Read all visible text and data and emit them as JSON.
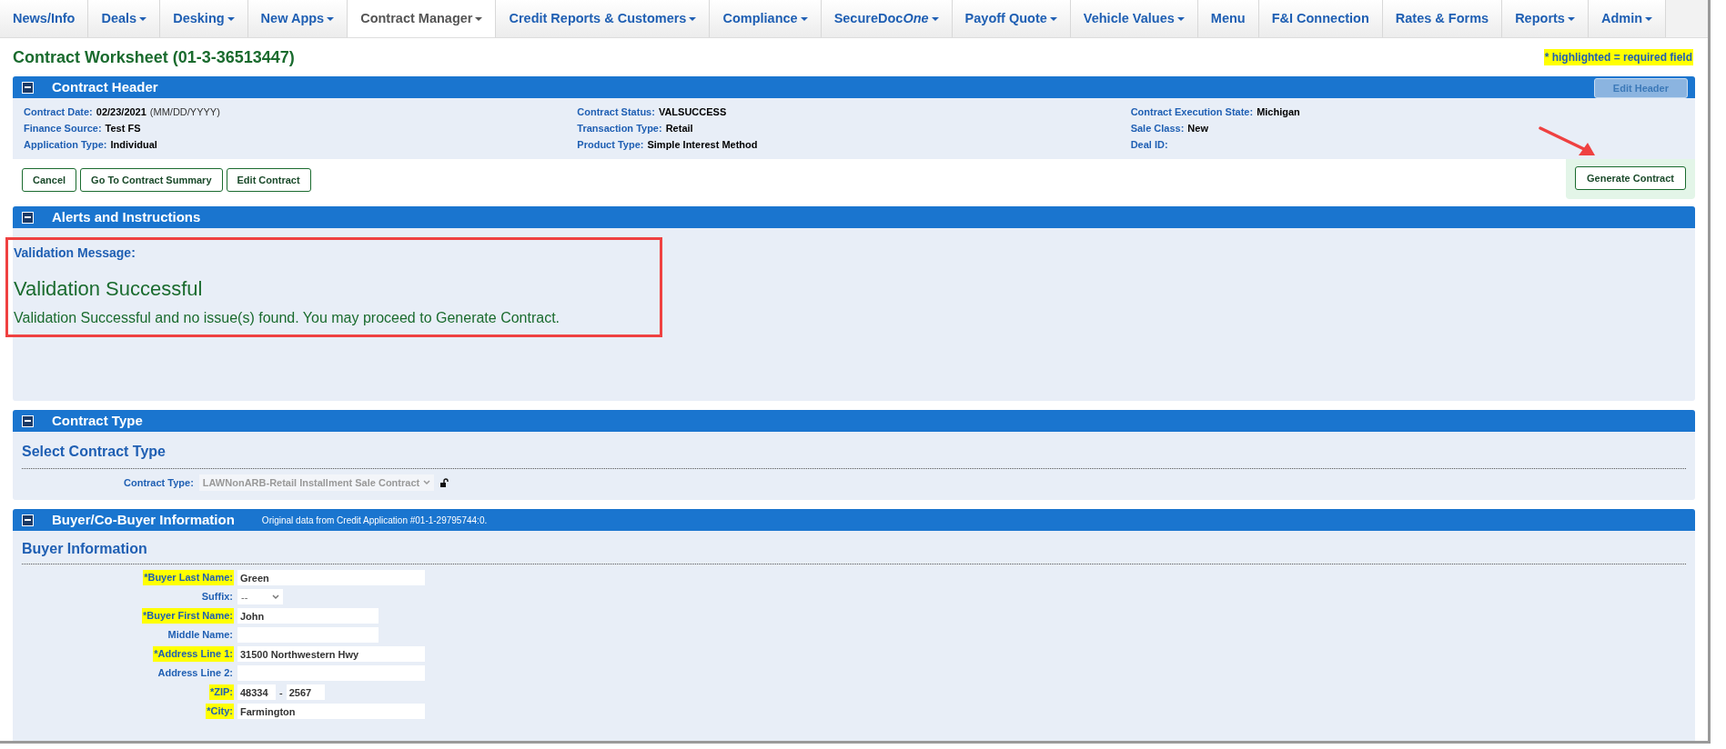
{
  "nav": [
    {
      "label": "News/Info",
      "dropdown": false,
      "selected": false
    },
    {
      "label": "Deals",
      "dropdown": true,
      "selected": false
    },
    {
      "label": "Desking",
      "dropdown": true,
      "selected": false
    },
    {
      "label": "New Apps",
      "dropdown": true,
      "selected": false
    },
    {
      "label": "Contract Manager",
      "dropdown": true,
      "selected": true
    },
    {
      "label": "Credit Reports & Customers",
      "dropdown": true,
      "selected": false
    },
    {
      "label": "Compliance",
      "dropdown": true,
      "selected": false
    },
    {
      "label": "SecureDoc",
      "label_italic": "One",
      "dropdown": true,
      "selected": false
    },
    {
      "label": "Payoff Quote",
      "dropdown": true,
      "selected": false
    },
    {
      "label": "Vehicle Values",
      "dropdown": true,
      "selected": false
    },
    {
      "label": "Menu",
      "dropdown": false,
      "selected": false
    },
    {
      "label": "F&I Connection",
      "dropdown": false,
      "selected": false
    },
    {
      "label": "Rates & Forms",
      "dropdown": false,
      "selected": false
    },
    {
      "label": "Reports",
      "dropdown": true,
      "selected": false
    },
    {
      "label": "Admin",
      "dropdown": true,
      "selected": false
    }
  ],
  "page_title": "Contract Worksheet (01-3-36513447)",
  "required_note": "* highlighted = required field",
  "contract_header": {
    "title": "Contract Header",
    "edit_button": "Edit Header",
    "columns": [
      [
        {
          "label": "Contract Date:",
          "value": "02/23/2021",
          "hint": "(MM/DD/YYYY)"
        },
        {
          "label": "Finance Source:",
          "value": "Test FS"
        },
        {
          "label": "Application Type:",
          "value": "Individual"
        }
      ],
      [
        {
          "label": "Contract Status:",
          "value": "VALSUCCESS"
        },
        {
          "label": "Transaction Type:",
          "value": "Retail"
        },
        {
          "label": "Product Type:",
          "value": "Simple Interest Method"
        }
      ],
      [
        {
          "label": "Contract Execution State:",
          "value": "Michigan"
        },
        {
          "label": "Sale Class:",
          "value": "New"
        },
        {
          "label": "Deal ID:"
        }
      ]
    ]
  },
  "actions": [
    "Cancel",
    "Go To Contract Summary",
    "Edit Contract"
  ],
  "generate_button": "Generate Contract",
  "alerts": {
    "title": "Alerts and Instructions",
    "label": "Validation Message:",
    "heading": "Validation Successful",
    "message": "Validation Successful and no issue(s) found. You may proceed to Generate Contract."
  },
  "contract_type": {
    "title": "Contract Type",
    "subtitle": "Select Contract Type",
    "label": "Contract Type:",
    "value": "LAWNonARB-Retail Installment Sale Contract",
    "disabled": true
  },
  "buyer": {
    "title": "Buyer/Co-Buyer Information",
    "note": "Original data from Credit Application #01-1-29795744:0.",
    "subtitle": "Buyer Information",
    "fields": [
      {
        "kind": "text",
        "label": "*Buyer Last Name:",
        "required": true,
        "value": "Green",
        "wide": true
      },
      {
        "kind": "select",
        "label": "Suffix:",
        "required": false,
        "value": "--"
      },
      {
        "kind": "text",
        "label": "*Buyer First Name:",
        "required": true,
        "value": "John",
        "wide": false
      },
      {
        "kind": "text",
        "label": "Middle Name:",
        "required": false,
        "wide": false
      },
      {
        "kind": "text",
        "label": "*Address Line 1:",
        "required": true,
        "value": "31500 Northwestern Hwy",
        "wide": true
      },
      {
        "kind": "text",
        "label": "Address Line 2:",
        "required": false,
        "wide": true
      },
      {
        "kind": "zip",
        "label": "*ZIP:",
        "required": true,
        "value": "48334",
        "value2": "2567",
        "separator": "-"
      },
      {
        "kind": "text",
        "label": "*City:",
        "required": true,
        "value": "Farmington",
        "wide": true
      }
    ]
  }
}
